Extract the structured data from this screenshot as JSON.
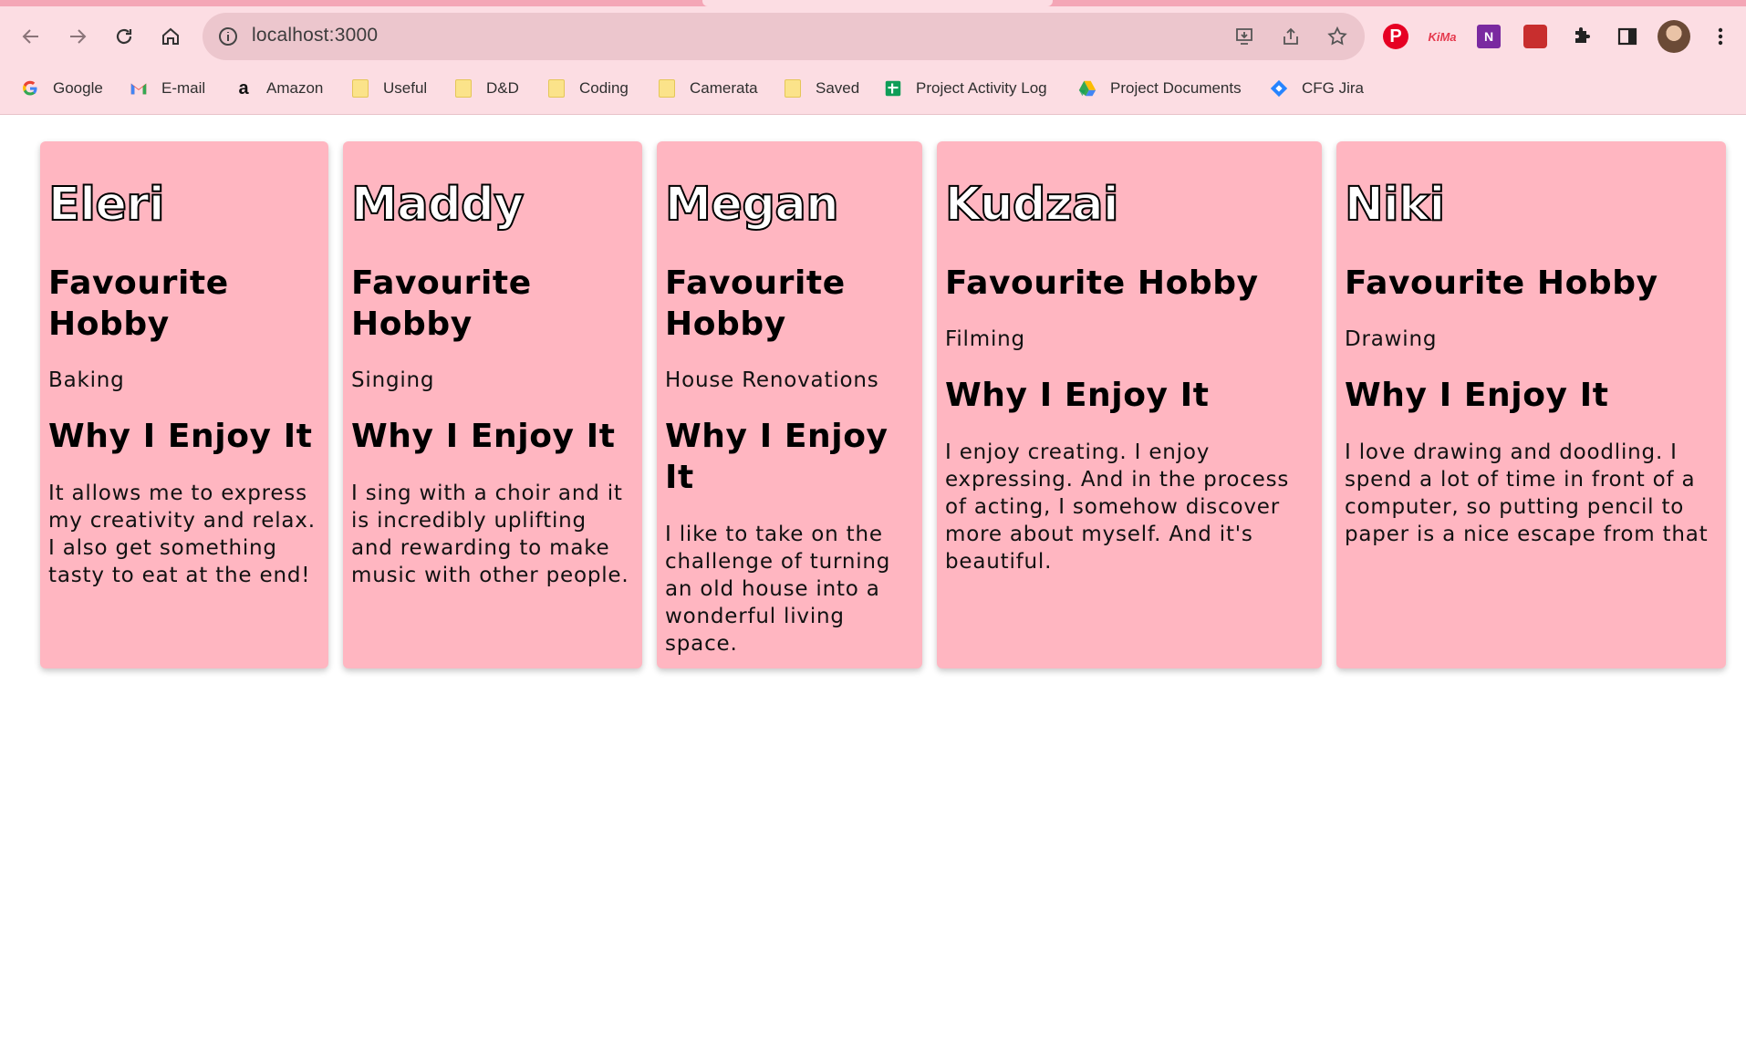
{
  "browser": {
    "url": "localhost:3000",
    "toolbar_icons": [
      "back-arrow-icon",
      "forward-arrow-icon",
      "reload-icon",
      "home-icon",
      "info-icon",
      "install-icon",
      "share-icon",
      "star-icon",
      "extensions-puzzle-icon",
      "side-panel-icon",
      "more-vert-icon"
    ],
    "extensions": [
      {
        "name": "pinterest-extension-icon",
        "glyph": "P"
      },
      {
        "name": "kiwi-extension-icon",
        "glyph": "KiMa"
      },
      {
        "name": "onenote-extension-icon",
        "glyph": "N"
      },
      {
        "name": "game-extension-icon",
        "glyph": ""
      }
    ],
    "bookmarks": [
      {
        "label": "Google",
        "icon": "google-icon"
      },
      {
        "label": "E-mail",
        "icon": "gmail-icon"
      },
      {
        "label": "Amazon",
        "icon": "amazon-icon"
      },
      {
        "label": "Useful",
        "icon": "folder-icon"
      },
      {
        "label": "D&D",
        "icon": "folder-icon"
      },
      {
        "label": "Coding",
        "icon": "folder-icon"
      },
      {
        "label": "Camerata",
        "icon": "folder-icon"
      },
      {
        "label": "Saved",
        "icon": "folder-icon"
      },
      {
        "label": "Project Activity Log",
        "icon": "sheets-icon"
      },
      {
        "label": "Project Documents",
        "icon": "drive-icon"
      },
      {
        "label": "CFG Jira",
        "icon": "jira-icon"
      }
    ],
    "colors": {
      "chrome": "#fcdde3",
      "tabstrip": "#f4a6b6",
      "omnibox": "#ecc6cd"
    }
  },
  "page": {
    "card_color": "#ffb6c1",
    "cards": [
      {
        "name": "Eleri",
        "hobby_heading": "Favourite Hobby",
        "hobby": "Baking",
        "why_heading": "Why I Enjoy It",
        "reason": "It allows me to express my creativity and relax. I also get something tasty to eat at the end!"
      },
      {
        "name": "Maddy",
        "hobby_heading": "Favourite Hobby",
        "hobby": "Singing",
        "why_heading": "Why I Enjoy It",
        "reason": "I sing with a choir and it is incredibly uplifting and rewarding to make music with other people."
      },
      {
        "name": "Megan",
        "hobby_heading": "Favourite Hobby",
        "hobby": "House Renovations",
        "why_heading": "Why I Enjoy It",
        "reason": "I like to take on the challenge of turning an old house into a wonderful living space."
      },
      {
        "name": "Kudzai",
        "hobby_heading": "Favourite Hobby",
        "hobby": "Filming",
        "why_heading": "Why I Enjoy It",
        "reason": "I enjoy creating. I enjoy expressing. And in the process of acting, I somehow discover more about myself. And it's beautiful."
      },
      {
        "name": "Niki",
        "hobby_heading": "Favourite Hobby",
        "hobby": "Drawing",
        "why_heading": "Why I Enjoy It",
        "reason": "I love drawing and doodling. I spend a lot of time in front of a computer, so putting pencil to paper is a nice escape from that"
      }
    ]
  }
}
